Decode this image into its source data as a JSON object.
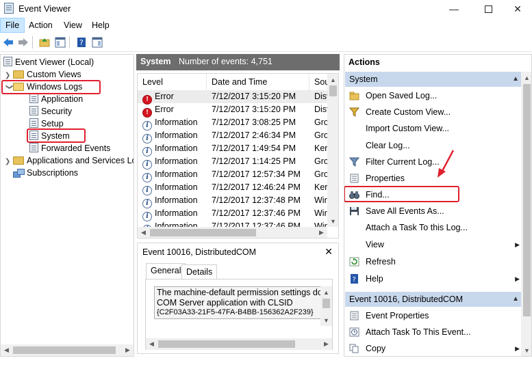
{
  "window": {
    "title": "Event Viewer"
  },
  "menu": {
    "file": "File",
    "action": "Action",
    "view": "View",
    "help": "Help"
  },
  "tree": {
    "root": "Event Viewer (Local)",
    "custom_views": "Custom Views",
    "windows_logs": "Windows Logs",
    "application": "Application",
    "security": "Security",
    "setup": "Setup",
    "system": "System",
    "forwarded": "Forwarded Events",
    "apps_services": "Applications and Services Lo",
    "subscriptions": "Subscriptions"
  },
  "log_header": {
    "name": "System",
    "count": "Number of events: 4,751"
  },
  "columns": {
    "level": "Level",
    "date": "Date and Time",
    "source": "Sou"
  },
  "events": [
    {
      "level": "Error",
      "type": "error",
      "date": "7/12/2017 3:15:20 PM",
      "source": "Dist"
    },
    {
      "level": "Error",
      "type": "error",
      "date": "7/12/2017 3:15:20 PM",
      "source": "Dist"
    },
    {
      "level": "Information",
      "type": "info",
      "date": "7/12/2017 3:08:25 PM",
      "source": "Gro"
    },
    {
      "level": "Information",
      "type": "info",
      "date": "7/12/2017 2:46:34 PM",
      "source": "Gro"
    },
    {
      "level": "Information",
      "type": "info",
      "date": "7/12/2017 1:49:54 PM",
      "source": "Ker"
    },
    {
      "level": "Information",
      "type": "info",
      "date": "7/12/2017 1:14:25 PM",
      "source": "Gro"
    },
    {
      "level": "Information",
      "type": "info",
      "date": "7/12/2017 12:57:34 PM",
      "source": "Gro"
    },
    {
      "level": "Information",
      "type": "info",
      "date": "7/12/2017 12:46:24 PM",
      "source": "Ker"
    },
    {
      "level": "Information",
      "type": "info",
      "date": "7/12/2017 12:37:48 PM",
      "source": "Wir"
    },
    {
      "level": "Information",
      "type": "info",
      "date": "7/12/2017 12:37:46 PM",
      "source": "Wir"
    },
    {
      "level": "Information",
      "type": "info",
      "date": "7/12/2017 12:37:46 PM",
      "source": "Wir"
    }
  ],
  "detail": {
    "title": "Event 10016, DistributedCOM",
    "tab_general": "General",
    "tab_details": "Details",
    "lines": [
      "The machine-default permission settings do",
      "COM Server application with CLSID",
      "{C2F03A33-21F5-47FA-B4BB-156362A2F239}"
    ]
  },
  "actions": {
    "title": "Actions",
    "section_system": "System",
    "items": {
      "open_saved": "Open Saved Log...",
      "create_view": "Create Custom View...",
      "import_view": "Import Custom View...",
      "clear_log": "Clear Log...",
      "filter": "Filter Current Log...",
      "properties": "Properties",
      "find": "Find...",
      "save_all": "Save All Events As...",
      "attach_task_log": "Attach a Task To this Log...",
      "view": "View",
      "refresh": "Refresh",
      "help": "Help"
    },
    "section_event": "Event 10016, DistributedCOM",
    "event_items": {
      "event_properties": "Event Properties",
      "attach_task_event": "Attach Task To This Event...",
      "copy": "Copy"
    }
  },
  "colors": {
    "highlight_red": "#e0202e",
    "section_blue": "#c8d8ec",
    "header_gray": "#6d6d6d"
  }
}
